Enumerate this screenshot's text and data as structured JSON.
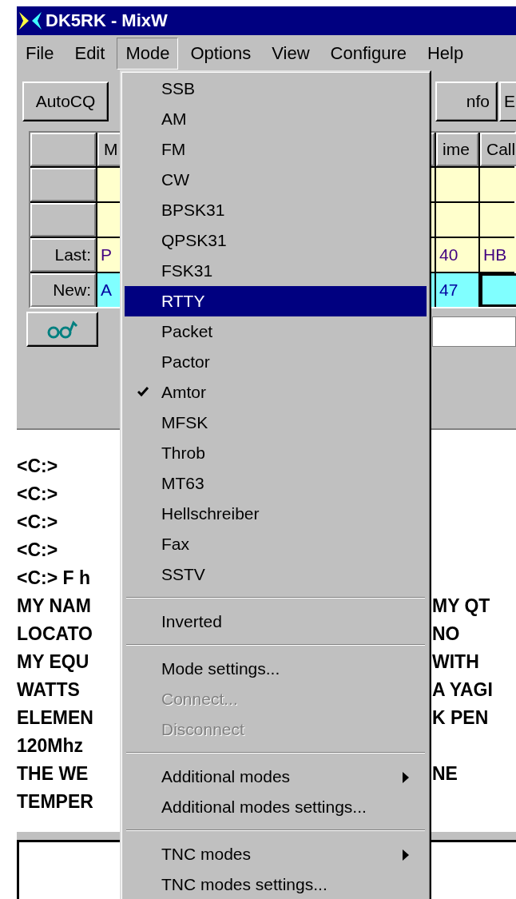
{
  "window": {
    "title": "DK5RK - MixW"
  },
  "menubar": [
    {
      "label": "File",
      "selected": false
    },
    {
      "label": "Edit",
      "selected": false
    },
    {
      "label": "Mode",
      "selected": true
    },
    {
      "label": "Options",
      "selected": false
    },
    {
      "label": "View",
      "selected": false
    },
    {
      "label": "Configure",
      "selected": false
    },
    {
      "label": "Help",
      "selected": false
    }
  ],
  "toolbar": {
    "left_button": "AutoCQ",
    "right_buttons": [
      "nfo",
      "E"
    ]
  },
  "grid": {
    "columns": [
      "M",
      "ime",
      "Call"
    ],
    "rows": [
      {
        "header": "",
        "cells": [
          "",
          "",
          ""
        ],
        "kind": "empty"
      },
      {
        "header": "",
        "cells": [
          "",
          "",
          ""
        ],
        "kind": "empty"
      },
      {
        "header": "Last:",
        "cells": [
          "P",
          "40",
          "HB"
        ],
        "kind": "last"
      },
      {
        "header": "New:",
        "cells": [
          "A",
          "47",
          ""
        ],
        "kind": "new"
      }
    ]
  },
  "output": {
    "lines": [
      {
        "left": "<C:>"
      },
      {
        "left": "<C:>"
      },
      {
        "left": "<C:>"
      },
      {
        "left": "<C:>"
      },
      {
        "left": "<C:> F h"
      },
      {
        "left": "MY NAM",
        "right": "MY QT"
      },
      {
        "left": "LOCATO",
        "right": "NO"
      },
      {
        "left": "MY EQU",
        "right": "WITH"
      },
      {
        "left": "WATTS",
        "right": "A YAGI"
      },
      {
        "left": "ELEMEN",
        "right": "K PEN"
      },
      {
        "left": "120Mhz"
      },
      {
        "left": "THE WE",
        "right": "NE"
      },
      {
        "left": "TEMPER"
      }
    ]
  },
  "mode_menu": [
    {
      "kind": "item",
      "label": "SSB",
      "selected": false,
      "checked": false,
      "disabled": false,
      "submenu": false
    },
    {
      "kind": "item",
      "label": "AM",
      "selected": false,
      "checked": false,
      "disabled": false,
      "submenu": false
    },
    {
      "kind": "item",
      "label": "FM",
      "selected": false,
      "checked": false,
      "disabled": false,
      "submenu": false
    },
    {
      "kind": "item",
      "label": "CW",
      "selected": false,
      "checked": false,
      "disabled": false,
      "submenu": false
    },
    {
      "kind": "item",
      "label": "BPSK31",
      "selected": false,
      "checked": false,
      "disabled": false,
      "submenu": false
    },
    {
      "kind": "item",
      "label": "QPSK31",
      "selected": false,
      "checked": false,
      "disabled": false,
      "submenu": false
    },
    {
      "kind": "item",
      "label": "FSK31",
      "selected": false,
      "checked": false,
      "disabled": false,
      "submenu": false
    },
    {
      "kind": "item",
      "label": "RTTY",
      "selected": true,
      "checked": false,
      "disabled": false,
      "submenu": false
    },
    {
      "kind": "item",
      "label": "Packet",
      "selected": false,
      "checked": false,
      "disabled": false,
      "submenu": false
    },
    {
      "kind": "item",
      "label": "Pactor",
      "selected": false,
      "checked": false,
      "disabled": false,
      "submenu": false
    },
    {
      "kind": "item",
      "label": "Amtor",
      "selected": false,
      "checked": true,
      "disabled": false,
      "submenu": false
    },
    {
      "kind": "item",
      "label": "MFSK",
      "selected": false,
      "checked": false,
      "disabled": false,
      "submenu": false
    },
    {
      "kind": "item",
      "label": "Throb",
      "selected": false,
      "checked": false,
      "disabled": false,
      "submenu": false
    },
    {
      "kind": "item",
      "label": "MT63",
      "selected": false,
      "checked": false,
      "disabled": false,
      "submenu": false
    },
    {
      "kind": "item",
      "label": "Hellschreiber",
      "selected": false,
      "checked": false,
      "disabled": false,
      "submenu": false
    },
    {
      "kind": "item",
      "label": "Fax",
      "selected": false,
      "checked": false,
      "disabled": false,
      "submenu": false
    },
    {
      "kind": "item",
      "label": "SSTV",
      "selected": false,
      "checked": false,
      "disabled": false,
      "submenu": false
    },
    {
      "kind": "separator"
    },
    {
      "kind": "item",
      "label": "Inverted",
      "selected": false,
      "checked": false,
      "disabled": false,
      "submenu": false
    },
    {
      "kind": "separator"
    },
    {
      "kind": "item",
      "label": "Mode settings...",
      "selected": false,
      "checked": false,
      "disabled": false,
      "submenu": false
    },
    {
      "kind": "item",
      "label": "Connect...",
      "selected": false,
      "checked": false,
      "disabled": true,
      "submenu": false
    },
    {
      "kind": "item",
      "label": "Disconnect",
      "selected": false,
      "checked": false,
      "disabled": true,
      "submenu": false
    },
    {
      "kind": "separator"
    },
    {
      "kind": "item",
      "label": "Additional modes",
      "selected": false,
      "checked": false,
      "disabled": false,
      "submenu": true
    },
    {
      "kind": "item",
      "label": "Additional modes settings...",
      "selected": false,
      "checked": false,
      "disabled": false,
      "submenu": false
    },
    {
      "kind": "separator"
    },
    {
      "kind": "item",
      "label": "TNC modes",
      "selected": false,
      "checked": false,
      "disabled": false,
      "submenu": true
    },
    {
      "kind": "item",
      "label": "TNC modes settings...",
      "selected": false,
      "checked": false,
      "disabled": false,
      "submenu": false
    }
  ]
}
